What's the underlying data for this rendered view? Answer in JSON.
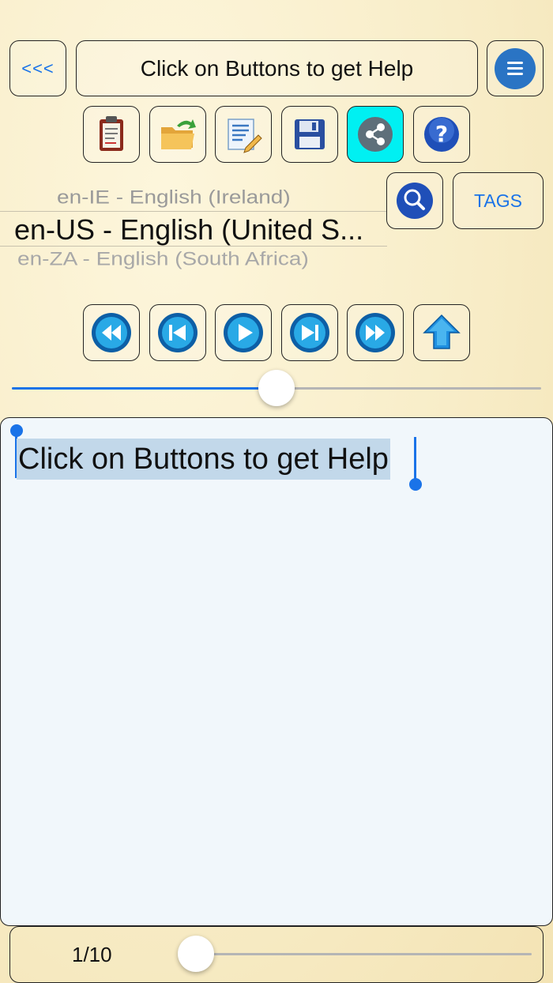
{
  "header": {
    "back_label": "<<<",
    "title": "Click on Buttons to get Help",
    "menu_icon": "hamburger-menu-icon"
  },
  "toolbar": {
    "tools": [
      {
        "name": "clipboard",
        "icon": "clipboard-icon"
      },
      {
        "name": "open-folder",
        "icon": "folder-open-icon"
      },
      {
        "name": "edit-document",
        "icon": "edit-document-icon"
      },
      {
        "name": "save",
        "icon": "floppy-disk-icon"
      },
      {
        "name": "share",
        "icon": "share-icon",
        "active": true
      },
      {
        "name": "help",
        "icon": "question-icon"
      }
    ],
    "active_color": "#00f0f2"
  },
  "language_picker": {
    "previous": "en-IE - English (Ireland)",
    "selected": "en-US - English (United S...",
    "next": "en-ZA - English (South Africa)"
  },
  "search_button": {
    "icon": "search-icon"
  },
  "tags_label": "TAGS",
  "media_controls": [
    {
      "name": "rewind",
      "icon": "rewind-icon"
    },
    {
      "name": "skip-back",
      "icon": "skip-back-icon"
    },
    {
      "name": "play",
      "icon": "play-icon"
    },
    {
      "name": "skip-forward",
      "icon": "skip-forward-icon"
    },
    {
      "name": "fast-forward",
      "icon": "fast-forward-icon"
    },
    {
      "name": "home-up",
      "icon": "arrow-up-icon"
    }
  ],
  "playback_slider": {
    "value": 0.5
  },
  "editor": {
    "text": "Click on Buttons to get Help"
  },
  "footer": {
    "page_label": "1/10",
    "page_slider_value": 0.0
  },
  "colors": {
    "accent": "#1a73e8",
    "menu_blue": "#2a74c4",
    "editor_bg": "#f1f7fb",
    "selection": "#c2d8ea"
  }
}
